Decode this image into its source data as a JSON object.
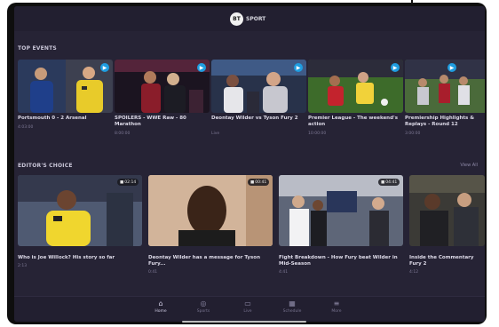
{
  "app": {
    "logo_mark": "BT",
    "logo_word": "SPORT"
  },
  "sections": {
    "top_events": {
      "title": "TOP EVENTS",
      "cards": [
        {
          "title": "Portsmouth 0 - 2 Arsenal",
          "meta": "4:03:00",
          "badge": "play-icon"
        },
        {
          "title": "SPOILERS - WWE Raw - 80 Marathon",
          "meta": "8:00:00",
          "badge": "play-icon"
        },
        {
          "title": "Deontay Wilder vs Tyson Fury 2",
          "meta": "Live",
          "badge": "play-icon"
        },
        {
          "title": "Premier League - The weekend's action",
          "meta": "10:00:00",
          "badge": "play-icon"
        },
        {
          "title": "Premiership Highlights & Replays - Round 12",
          "meta": "3:00:00",
          "badge": "play-icon"
        }
      ]
    },
    "editors_choice": {
      "title": "EDITOR'S CHOICE",
      "view_all": "View All",
      "cards": [
        {
          "title": "Who is Joe Willock? His story so far",
          "meta": "2:13",
          "pill": "02:14"
        },
        {
          "title": "Deontay Wilder has a message for Tyson Fury...",
          "meta": "0:41",
          "pill": "00:41"
        },
        {
          "title": "Fight Breakdown - How Fury beat Wilder in Mid-Season",
          "meta": "4:41",
          "pill": "04:41"
        },
        {
          "title": "Inside the Commentary Fury 2",
          "meta": "4:12",
          "pill": ""
        }
      ]
    }
  },
  "bottom_nav": {
    "tabs": [
      {
        "label": "Home",
        "icon": "home-icon",
        "glyph": "⌂"
      },
      {
        "label": "Sports",
        "icon": "ball-icon",
        "glyph": "◎"
      },
      {
        "label": "Live",
        "icon": "tv-icon",
        "glyph": "▭"
      },
      {
        "label": "Schedule",
        "icon": "calendar-icon",
        "glyph": "▦"
      },
      {
        "label": "More",
        "icon": "menu-icon",
        "glyph": "≡"
      }
    ]
  },
  "colors": {
    "background": "#262335",
    "accent": "#1f9de0",
    "text": "#dddae8"
  }
}
